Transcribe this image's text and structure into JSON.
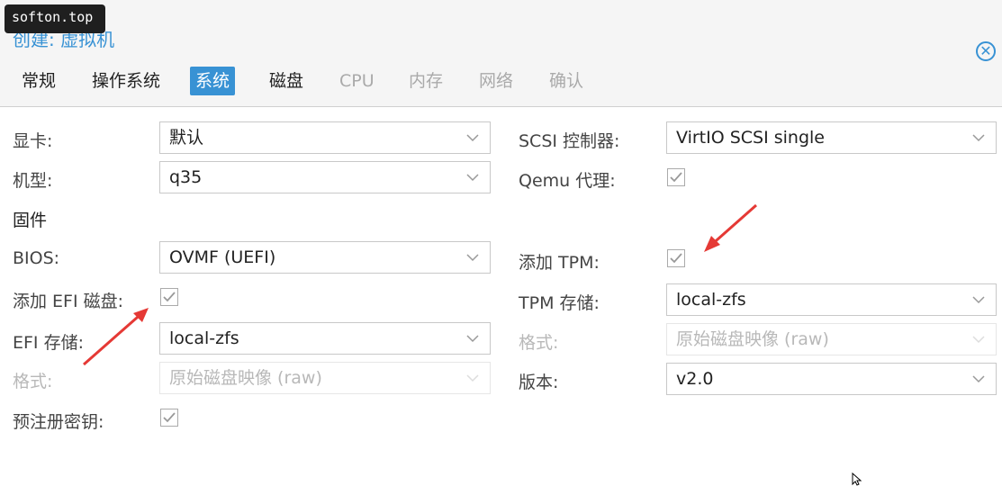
{
  "watermark": "softon.top",
  "window": {
    "title": "创建: 虚拟机"
  },
  "tabs": [
    {
      "label": "常规",
      "state": "normal"
    },
    {
      "label": "操作系统",
      "state": "normal"
    },
    {
      "label": "系统",
      "state": "active"
    },
    {
      "label": "磁盘",
      "state": "normal"
    },
    {
      "label": "CPU",
      "state": "disabled"
    },
    {
      "label": "内存",
      "state": "disabled"
    },
    {
      "label": "网络",
      "state": "disabled"
    },
    {
      "label": "确认",
      "state": "disabled"
    }
  ],
  "left": {
    "graphics_label": "显卡:",
    "graphics_value": "默认",
    "machine_label": "机型:",
    "machine_value": "q35",
    "firmware_section": "固件",
    "bios_label": "BIOS:",
    "bios_value": "OVMF (UEFI)",
    "add_efi_label": "添加 EFI 磁盘:",
    "add_efi_checked": true,
    "efi_storage_label": "EFI 存储:",
    "efi_storage_value": "local-zfs",
    "efi_format_label": "格式:",
    "efi_format_value": "原始磁盘映像 (raw)",
    "pre_enroll_label": "预注册密钥:",
    "pre_enroll_checked": true
  },
  "right": {
    "scsi_label": "SCSI 控制器:",
    "scsi_value": "VirtIO SCSI single",
    "qemu_agent_label": "Qemu 代理:",
    "qemu_agent_checked": true,
    "add_tpm_label": "添加 TPM:",
    "add_tpm_checked": true,
    "tpm_storage_label": "TPM 存储:",
    "tpm_storage_value": "local-zfs",
    "tpm_format_label": "格式:",
    "tpm_format_value": "原始磁盘映像 (raw)",
    "version_label": "版本:",
    "version_value": "v2.0"
  },
  "colors": {
    "accent": "#3892d4",
    "annotation": "#e53935",
    "disabled": "#b8b8b8"
  }
}
